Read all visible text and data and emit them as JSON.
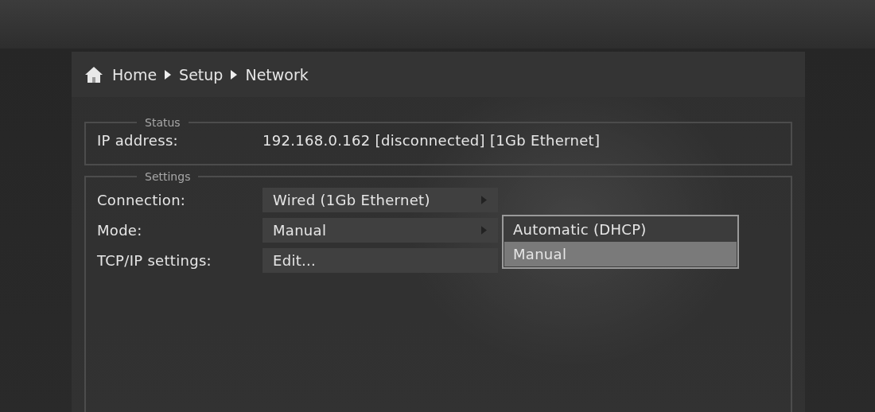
{
  "breadcrumb": [
    "Home",
    "Setup",
    "Network"
  ],
  "status": {
    "title": "Status",
    "rows": [
      {
        "label": "IP address:",
        "value": "192.168.0.162 [disconnected] [1Gb Ethernet]"
      }
    ]
  },
  "settings": {
    "title": "Settings",
    "rows": [
      {
        "label": "Connection:",
        "value": "Wired (1Gb Ethernet)",
        "kind": "submenu"
      },
      {
        "label": "Mode:",
        "value": "Manual",
        "kind": "submenu",
        "menu": [
          {
            "label": "Automatic (DHCP)",
            "selected": false
          },
          {
            "label": "Manual",
            "selected": true
          }
        ]
      },
      {
        "label": "TCP/IP settings:",
        "value": "Edit...",
        "kind": "action"
      }
    ]
  }
}
